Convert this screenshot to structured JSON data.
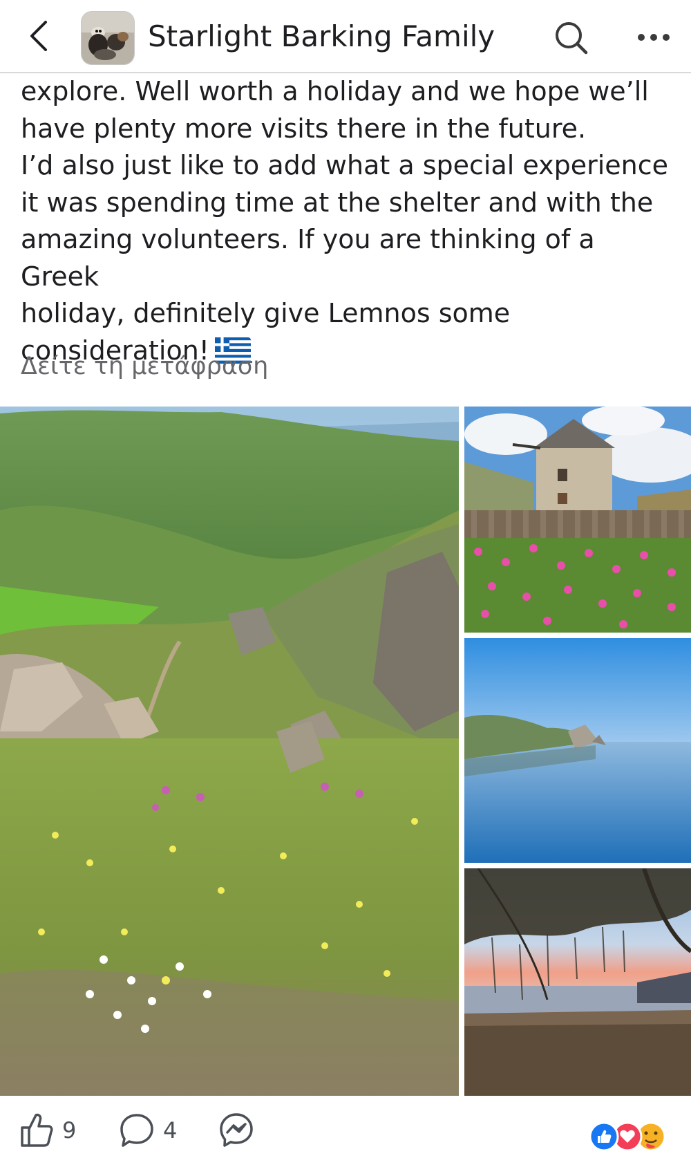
{
  "header": {
    "page_name": "Starlight Barking Family",
    "back_icon": "chevron-left-icon",
    "search_icon": "search-icon",
    "more_icon": "more-dots-icon"
  },
  "post": {
    "lines": [
      "explore. Well worth a holiday and we hope we’ll",
      "have plenty more visits there in the future.",
      "I’d also just like to add what a special experience",
      "it was spending time at the shelter and with the",
      "amazing volunteers. If you are thinking of a Greek",
      "holiday, definitely give Lemnos some",
      "consideration!"
    ],
    "flag_icon": "greek-flag-emoji",
    "translate_link": "Δείτε τη μετάφραση"
  },
  "photos": [
    {
      "name": "photo-green-valley-wildflowers"
    },
    {
      "name": "photo-stone-windmill-pink-flowers"
    },
    {
      "name": "photo-calm-sea-cliffs"
    },
    {
      "name": "photo-sunset-beach-tree"
    }
  ],
  "actions": {
    "like_count": "9",
    "comment_count": "4",
    "like_icon": "thumbs-up-icon",
    "comment_icon": "comment-bubble-icon",
    "messenger_icon": "messenger-icon"
  },
  "reactions": {
    "icons": [
      "like-reaction-icon",
      "love-reaction-icon",
      "care-reaction-icon"
    ],
    "colors": {
      "like": "#1877f2",
      "love": "#f33e58",
      "care": "#f7b125"
    }
  }
}
